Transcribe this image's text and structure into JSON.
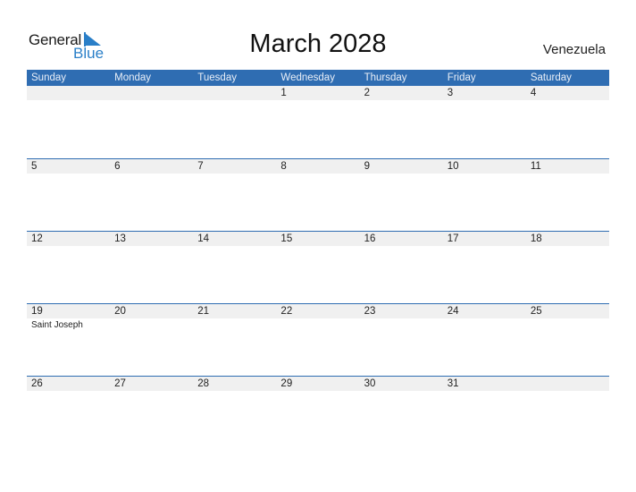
{
  "logo": {
    "line1": "General",
    "line2": "Blue"
  },
  "title": "March 2028",
  "country": "Venezuela",
  "colors": {
    "header_bg": "#2f6db2",
    "accent": "#2a7fc8",
    "row_bg": "#f0f0f0"
  },
  "weekdays": [
    "Sunday",
    "Monday",
    "Tuesday",
    "Wednesday",
    "Thursday",
    "Friday",
    "Saturday"
  ],
  "weeks": [
    {
      "days": [
        "",
        "",
        "",
        "1",
        "2",
        "3",
        "4"
      ],
      "events": [
        "",
        "",
        "",
        "",
        "",
        "",
        ""
      ]
    },
    {
      "days": [
        "5",
        "6",
        "7",
        "8",
        "9",
        "10",
        "11"
      ],
      "events": [
        "",
        "",
        "",
        "",
        "",
        "",
        ""
      ]
    },
    {
      "days": [
        "12",
        "13",
        "14",
        "15",
        "16",
        "17",
        "18"
      ],
      "events": [
        "",
        "",
        "",
        "",
        "",
        "",
        ""
      ]
    },
    {
      "days": [
        "19",
        "20",
        "21",
        "22",
        "23",
        "24",
        "25"
      ],
      "events": [
        "Saint Joseph",
        "",
        "",
        "",
        "",
        "",
        ""
      ]
    },
    {
      "days": [
        "26",
        "27",
        "28",
        "29",
        "30",
        "31",
        ""
      ],
      "events": [
        "",
        "",
        "",
        "",
        "",
        "",
        ""
      ]
    }
  ]
}
